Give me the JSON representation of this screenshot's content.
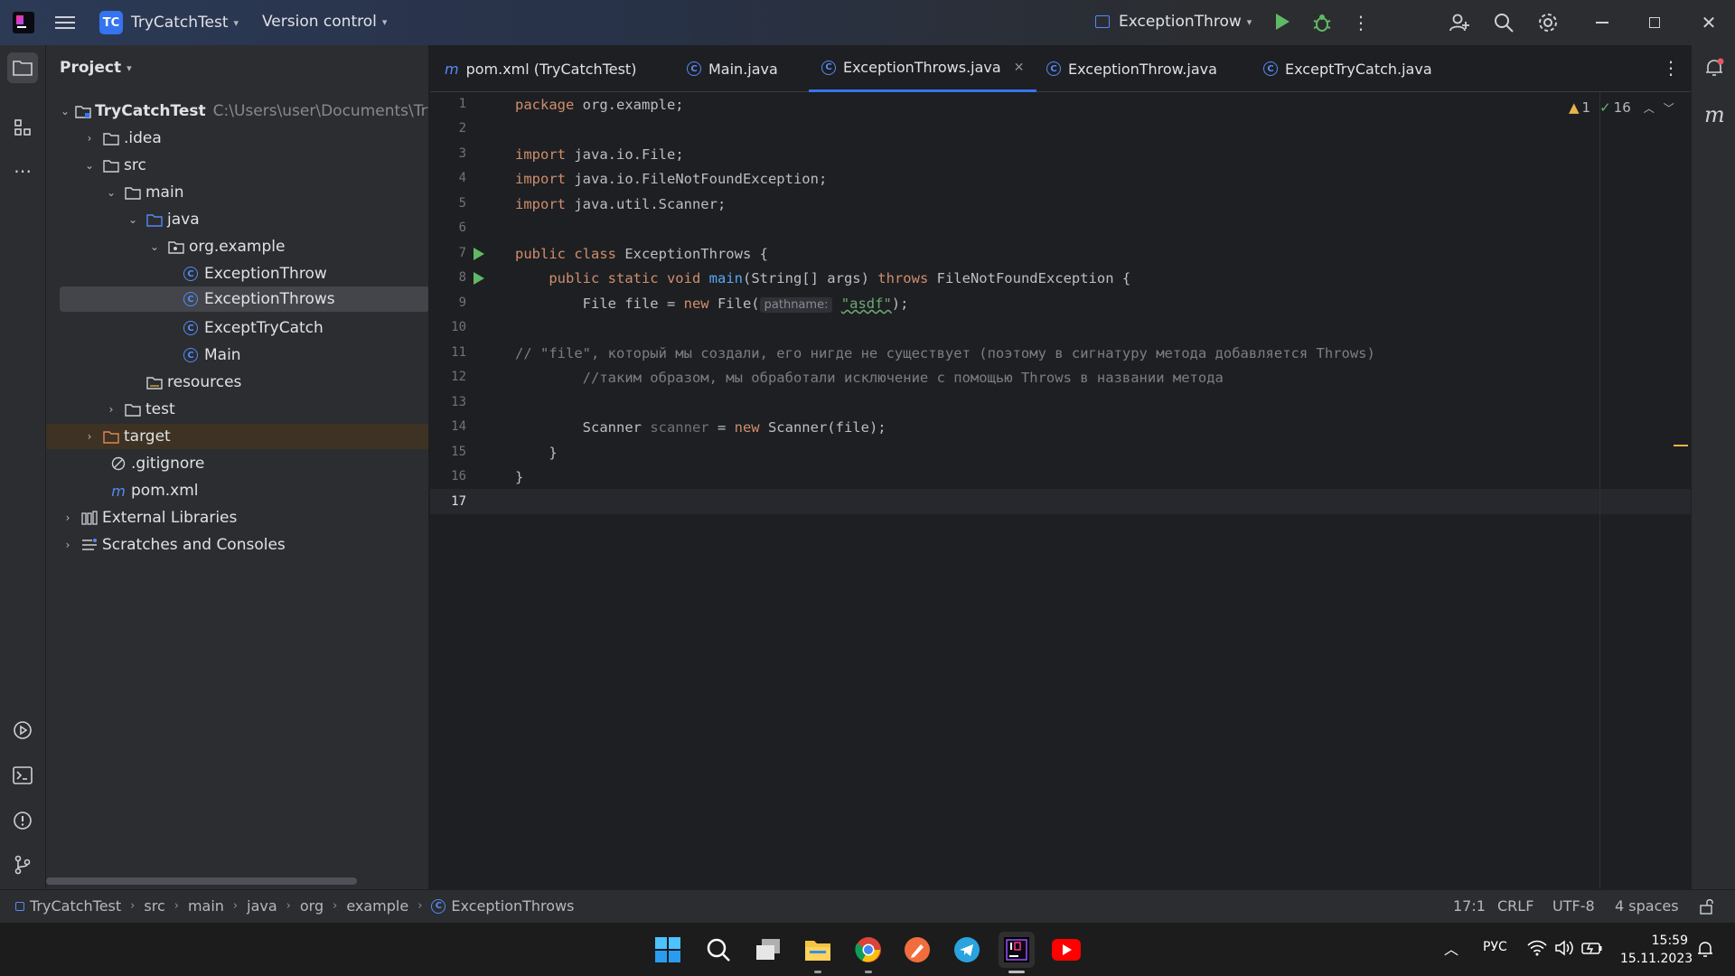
{
  "titlebar": {
    "project_badge": "TC",
    "project_name": "TryCatchTest",
    "vcs_menu": "Version control",
    "run_config": "ExceptionThrow"
  },
  "project_panel": {
    "title": "Project",
    "root_name": "TryCatchTest",
    "root_path": "C:\\Users\\user\\Documents\\TryCatchTest",
    "items": [
      {
        "label": ".idea"
      },
      {
        "label": "src"
      },
      {
        "label": "main"
      },
      {
        "label": "java"
      },
      {
        "label": "org.example"
      },
      {
        "label": "ExceptionThrow"
      },
      {
        "label": "ExceptionThrows"
      },
      {
        "label": "ExceptTryCatch"
      },
      {
        "label": "Main"
      },
      {
        "label": "resources"
      },
      {
        "label": "test"
      },
      {
        "label": "target"
      },
      {
        "label": ".gitignore"
      },
      {
        "label": "pom.xml"
      },
      {
        "label": "External Libraries"
      },
      {
        "label": "Scratches and Consoles"
      }
    ]
  },
  "tabs": [
    {
      "label": "pom.xml (TryCatchTest)"
    },
    {
      "label": "Main.java"
    },
    {
      "label": "ExceptionThrows.java"
    },
    {
      "label": "ExceptionThrow.java"
    },
    {
      "label": "ExceptTryCatch.java"
    }
  ],
  "inspections": {
    "warnings": "1",
    "ok": "16"
  },
  "code": {
    "line_numbers": [
      "1",
      "2",
      "3",
      "4",
      "5",
      "6",
      "7",
      "8",
      "9",
      "10",
      "11",
      "12",
      "13",
      "14",
      "15",
      "16",
      "17"
    ],
    "l1_kw": "package",
    "l1_rest": " org.example;",
    "l3_kw": "import",
    "l3_rest": " java.io.File;",
    "l4_kw": "import",
    "l4_rest": " java.io.FileNotFoundException;",
    "l5_kw": "import",
    "l5_rest": " java.util.Scanner;",
    "l7_kw": "public class",
    "l7_rest": " ExceptionThrows {",
    "l8_kw1": "    public static void",
    "l8_fn": "main",
    "l8_mid": "(String[] args) ",
    "l8_kw2": "throws",
    "l8_rest": " FileNotFoundException {",
    "l9_a": "        File file = ",
    "l9_kw": "new",
    "l9_b": " File(",
    "l9_hint": "pathname:",
    "l9_str": "\"asdf\"",
    "l9_c": ");",
    "l11": "// \"file\", который мы создали, его нигде не существует (поэтому в сигнатуру метода добавляется Throws)",
    "l12": "        //таким образом, мы обработали исключение с помощью Throws в названии метода",
    "l14_a": "        Scanner ",
    "l14_var": "scanner",
    "l14_b": " = ",
    "l14_kw": "new",
    "l14_c": " Scanner(file);",
    "l15": "    }",
    "l16": "}"
  },
  "statusbar": {
    "breadcrumbs": [
      "TryCatchTest",
      "src",
      "main",
      "java",
      "org",
      "example",
      "ExceptionThrows"
    ],
    "position": "17:1",
    "line_sep": "CRLF",
    "encoding": "UTF-8",
    "indent": "4 spaces"
  },
  "taskbar": {
    "lang": "РУС",
    "time": "15:59",
    "date": "15.11.2023"
  },
  "colors": {
    "accent": "#3574f0",
    "run_green": "#5fb865",
    "keyword": "#cf8e6d",
    "string": "#6aab73"
  }
}
